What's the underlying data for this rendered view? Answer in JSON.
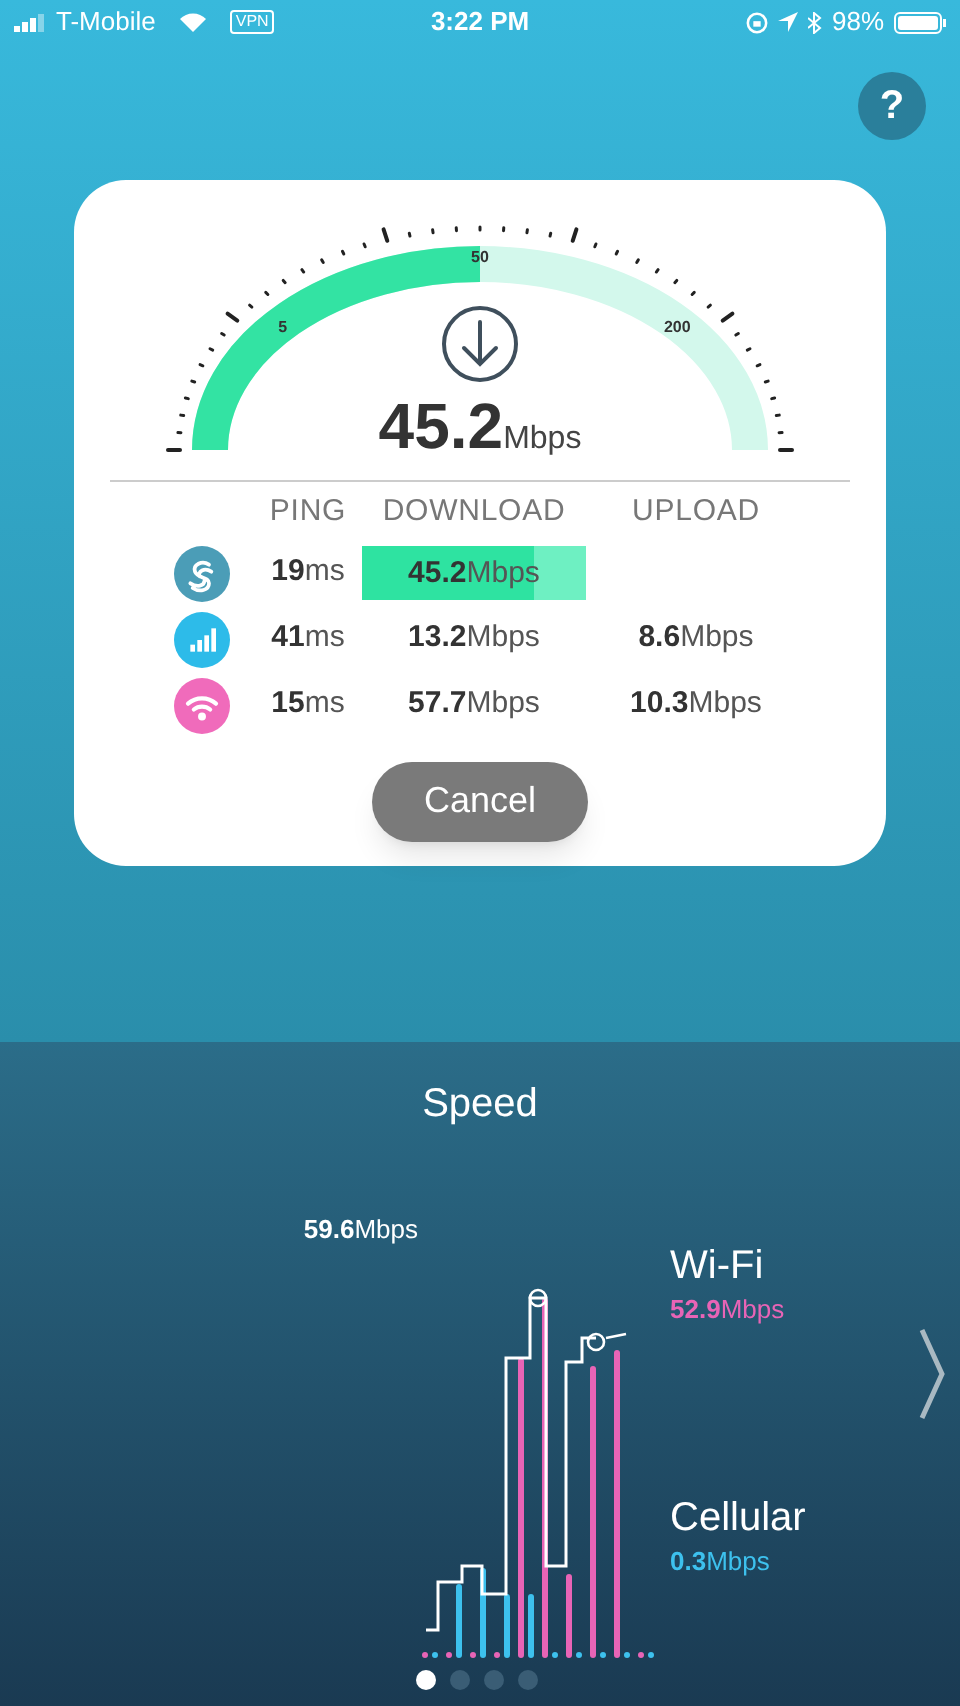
{
  "status_bar": {
    "carrier": "T-Mobile",
    "vpn": "VPN",
    "time": "3:22 PM",
    "battery": "98%"
  },
  "help_button": "?",
  "gauge": {
    "labels": [
      "5",
      "50",
      "200"
    ],
    "value": "45.2",
    "unit": "Mbps"
  },
  "table": {
    "columns": [
      "PING",
      "DOWNLOAD",
      "UPLOAD"
    ],
    "rows": [
      {
        "kind": "server",
        "color": "#4b9db7",
        "ping": {
          "value": "19",
          "unit": "ms"
        },
        "download": {
          "value": "45.2",
          "unit": "Mbps",
          "level": 0.77
        }
      },
      {
        "kind": "cellular",
        "color": "#2dbbe9",
        "ping": {
          "value": "41",
          "unit": "ms"
        },
        "download": {
          "value": "13.2",
          "unit": "Mbps"
        },
        "upload": {
          "value": "8.6",
          "unit": "Mbps"
        }
      },
      {
        "kind": "wifi",
        "color": "#f06bbb",
        "ping": {
          "value": "15",
          "unit": "ms"
        },
        "download": {
          "value": "57.7",
          "unit": "Mbps"
        },
        "upload": {
          "value": "10.3",
          "unit": "Mbps"
        }
      }
    ]
  },
  "cancel_button": "Cancel",
  "speed": {
    "title": "Speed",
    "peak": {
      "value": "59.6",
      "unit": "Mbps"
    },
    "legend": [
      {
        "name": "Wi-Fi",
        "value": "52.9",
        "unit": "Mbps",
        "color": "#e864b6"
      },
      {
        "name": "Cellular",
        "value": "0.3",
        "unit": "Mbps",
        "color": "#3dc1ee"
      }
    ],
    "pages": [
      {
        "selected": true
      },
      {
        "selected": false
      },
      {
        "selected": false
      },
      {
        "selected": false
      }
    ]
  }
}
